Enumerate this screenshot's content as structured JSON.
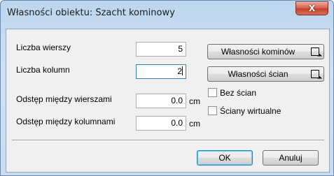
{
  "window": {
    "title": "Własności obiektu: Szacht kominowy",
    "close_label": "X"
  },
  "fields": {
    "rows": {
      "label": "Liczba wierszy",
      "value": "5"
    },
    "cols": {
      "label": "Liczba kolumn",
      "value": "2"
    },
    "row_spacing": {
      "label": "Odstęp między wierszami",
      "value": "0.0",
      "unit": "cm"
    },
    "col_spacing": {
      "label": "Odstęp między kolumnami",
      "value": "0.0",
      "unit": "cm"
    }
  },
  "buttons": {
    "chimney_props": "Własności kominów",
    "wall_props": "Własności ścian",
    "ok": "OK",
    "cancel": "Anuluj"
  },
  "checkboxes": {
    "no_walls": {
      "label": "Bez ścian",
      "checked": false
    },
    "virtual_walls": {
      "label": "Ściany wirtualne",
      "checked": false
    }
  }
}
